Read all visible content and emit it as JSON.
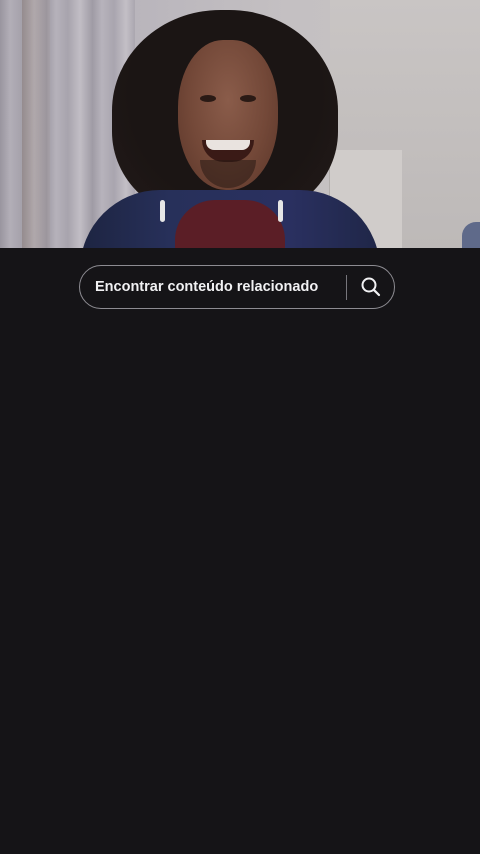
{
  "video": {
    "description_icon": "video-frame"
  },
  "search": {
    "label": "Encontrar conteúdo relacionado",
    "icon": "search-icon"
  },
  "colors": {
    "background": "#151417",
    "pill_border": "#8d8c92",
    "text": "#f1f1f3"
  }
}
